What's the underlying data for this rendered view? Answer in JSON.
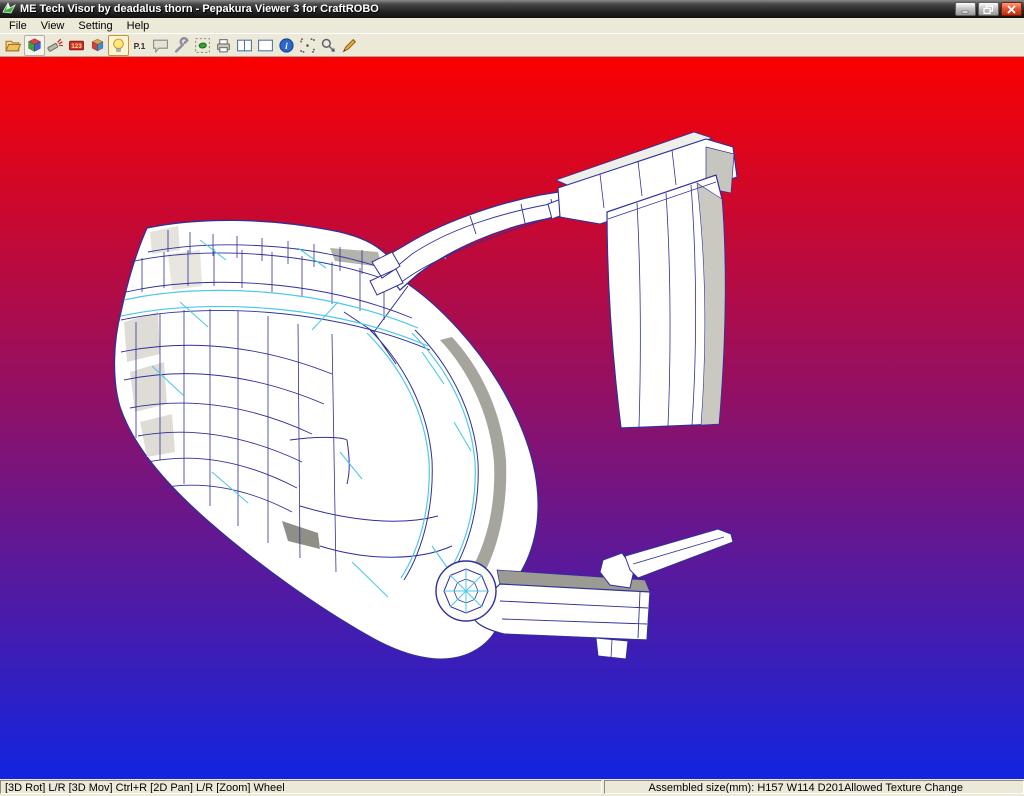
{
  "window": {
    "title": "ME Tech Visor by deadalus thorn - Pepakura Viewer 3 for CraftROBO"
  },
  "menu": {
    "items": [
      "File",
      "View",
      "Setting",
      "Help"
    ]
  },
  "toolbar": {
    "icons": [
      {
        "name": "open-file-icon",
        "pressed": false
      },
      {
        "name": "view-3d-cube-icon",
        "pressed": true
      },
      {
        "name": "airbrush-icon",
        "pressed": false
      },
      {
        "name": "edge-id-icon",
        "pressed": false
      },
      {
        "name": "texture-cube-icon",
        "pressed": false
      },
      {
        "name": "light-bulb-icon",
        "pressed": true
      },
      {
        "name": "page-number-icon",
        "pressed": false
      },
      {
        "name": "comment-balloon-icon",
        "pressed": false
      },
      {
        "name": "settings-wrench-icon",
        "pressed": false
      },
      {
        "name": "select-part-icon",
        "pressed": false
      },
      {
        "name": "print-icon",
        "pressed": false
      },
      {
        "name": "split-view-icon",
        "pressed": false
      },
      {
        "name": "single-view-icon",
        "pressed": false
      },
      {
        "name": "info-icon",
        "pressed": false
      },
      {
        "name": "zoom-region-icon",
        "pressed": false
      },
      {
        "name": "zoom-fit-icon",
        "pressed": false
      },
      {
        "name": "edit-pen-icon",
        "pressed": false
      }
    ]
  },
  "viewport": {
    "colors": {
      "gradient_top": "#fa0101",
      "gradient_bottom": "#1224df",
      "mesh_edge": "#30309b",
      "fold_line": "#4ec9e8",
      "face": "#ffffff"
    }
  },
  "statusbar": {
    "left": "[3D Rot] L/R [3D Mov] Ctrl+R [2D Pan] L/R [Zoom] Wheel",
    "assembled_size": "Assembled size(mm): H157 W114 D201",
    "texture": "Allowed Texture Change"
  }
}
